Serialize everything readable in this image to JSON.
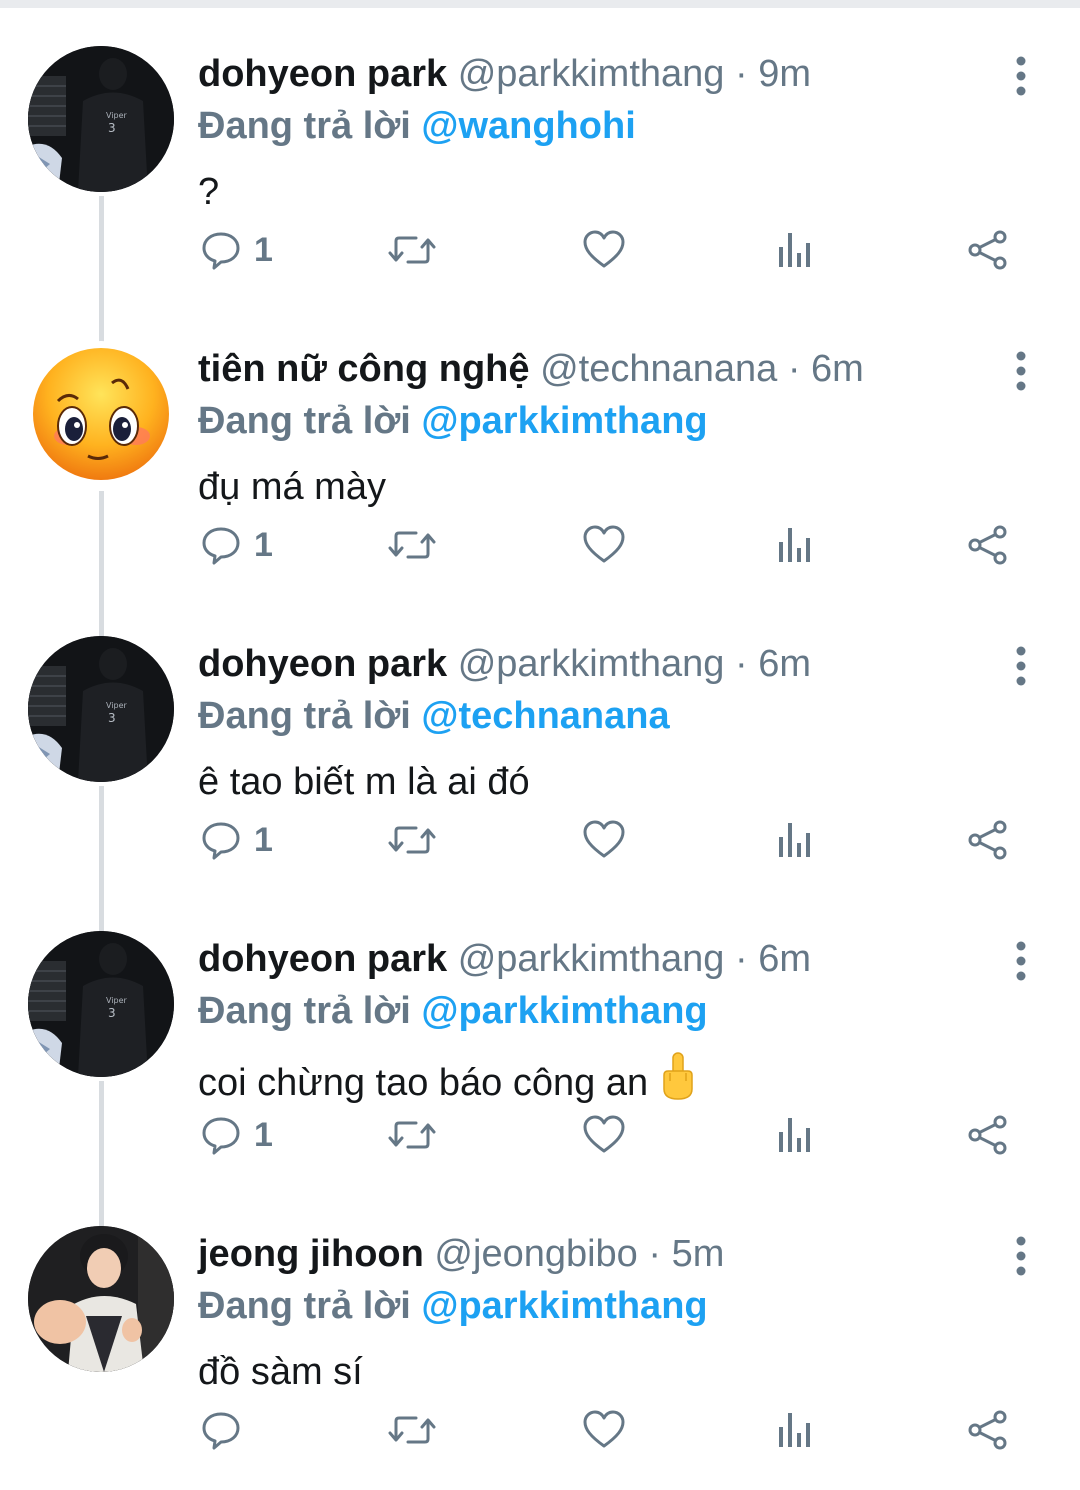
{
  "colors": {
    "accent": "#1da1f2",
    "muted": "#657786",
    "text": "#14171a",
    "divider": "#d8dce0"
  },
  "icons": {
    "reply": "comment-bubble-icon",
    "retweet": "retweet-icon",
    "like": "heart-icon",
    "views": "bar-chart-icon",
    "share": "share-icon",
    "more": "kebab-menu-icon"
  },
  "tweets": [
    {
      "name": "dohyeon park",
      "handle": "@parkkimthang",
      "dot": "·",
      "time": "9m",
      "reply_prefix": "Đang trả lời",
      "reply_to": "@wanghohi",
      "text": "?",
      "reply_count": "1",
      "avatar": "viper-jersey-avatar"
    },
    {
      "name": "tiên nữ công nghệ",
      "handle": "@technanana",
      "dot": "·",
      "time": "6m",
      "reply_prefix": "Đang trả lời",
      "reply_to": "@parkkimthang",
      "text": "đụ má mày",
      "reply_count": "1",
      "avatar": "smiley-face-avatar"
    },
    {
      "name": "dohyeon park",
      "handle": "@parkkimthang",
      "dot": "·",
      "time": "6m",
      "reply_prefix": "Đang trả lời",
      "reply_to": "@technanana",
      "text": "ê tao biết m là ai đó",
      "reply_count": "1",
      "avatar": "viper-jersey-avatar"
    },
    {
      "name": "dohyeon park",
      "handle": "@parkkimthang",
      "dot": "·",
      "time": "6m",
      "reply_prefix": "Đang trả lời",
      "reply_to": "@parkkimthang",
      "text": "coi chừng tao báo công an",
      "emoji": "middle-finger-emoji",
      "reply_count": "1",
      "avatar": "viper-jersey-avatar"
    },
    {
      "name": "jeong jihoon",
      "handle": "@jeongbibo",
      "dot": "·",
      "time": "5m",
      "reply_prefix": "Đang trả lời",
      "reply_to": "@parkkimthang",
      "text": "đồ sàm sí",
      "reply_count": "",
      "avatar": "person-photo-avatar"
    }
  ]
}
